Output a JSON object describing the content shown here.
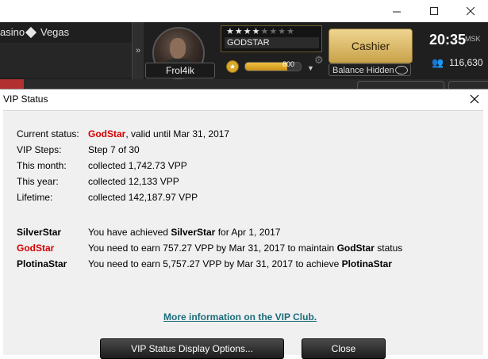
{
  "window": {
    "controls": [
      "minimize",
      "maximize",
      "close"
    ]
  },
  "header": {
    "tabs": [
      "asino",
      "Vegas"
    ],
    "username": "Frol4ik",
    "stars_total": 8,
    "stars_on": 4,
    "status_name": "GODSTAR",
    "vpp_value": "800",
    "vpp_fraction": 0.75,
    "cashier_label": "Cashier",
    "balance_label": "Balance Hidden",
    "time": "20:35",
    "timezone": "MSK",
    "players_online": "116,630",
    "colors": {
      "accent_gold": "#c9a24a",
      "status_red": "#d40000",
      "link": "#1a6c7a"
    }
  },
  "dialog": {
    "title": "VIP Status",
    "current_status_label": "Current status:",
    "current_status_name": "GodStar",
    "current_status_rest": ", valid until Mar 31, 2017",
    "steps_label": "VIP Steps:",
    "steps_value": "Step 7 of 30",
    "month_label": "This month:",
    "month_value": "collected 1,742.73 VPP",
    "year_label": "This year:",
    "year_value": "collected 12,133 VPP",
    "lifetime_label": "Lifetime:",
    "lifetime_value": "collected 142,187.97 VPP",
    "silver_label": "SilverStar",
    "silver_pre": "You have achieved ",
    "silver_name": "SilverStar",
    "silver_post": " for Apr 1, 2017",
    "god_label": "GodStar",
    "god_pre": "You need to earn 757.27 VPP by Mar 31, 2017 to maintain ",
    "god_name": "GodStar",
    "god_post": " status",
    "plat_label": "PlotinaStar",
    "plat_pre": "You need to earn 5,757.27 VPP by Mar 31, 2017 to achieve ",
    "plat_name": "PlotinaStar",
    "link_text": "More information on the VIP Club.",
    "options_button": "VIP Status Display Options...",
    "close_button": "Close"
  }
}
